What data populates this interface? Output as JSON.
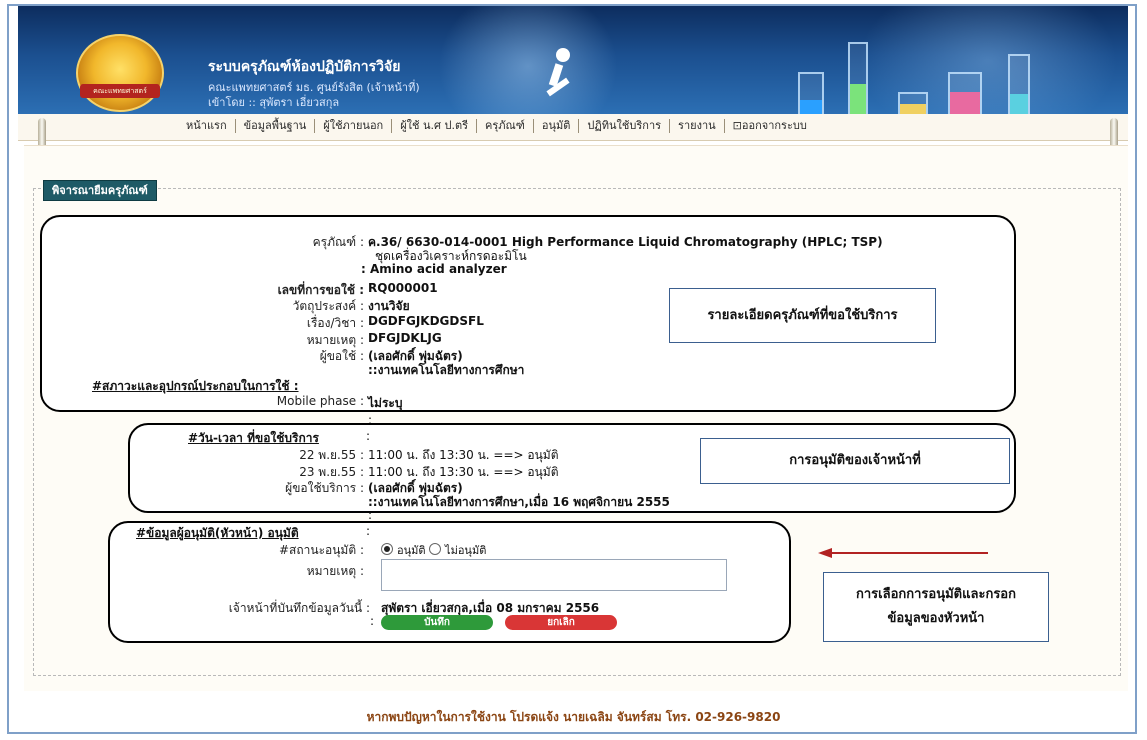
{
  "header": {
    "title": "ระบบครุภัณฑ์ห้องปฏิบัติการวิจัย",
    "subtitle": "คณะแพทยศาสตร์ มธ. ศูนย์รังสิต (เจ้าหน้าที่)",
    "login_text": "เข้าโดย :: สุพัตรา เอี่ยวสกุล"
  },
  "nav": {
    "items": [
      "หน้าแรก",
      "ข้อมูลพื้นฐาน",
      "ผู้ใช้ภายนอก",
      "ผู้ใช้ น.ศ ป.ตรี",
      "ครุภัณฑ์",
      "อนุมัติ",
      "ปฏิทินใช้บริการ",
      "รายงาน",
      "ออกจากระบบ"
    ]
  },
  "legend": "พิจารณายืมครุภัณฑ์",
  "equipment": {
    "label": "ครุภัณฑ์ :",
    "value_line1": "ค.36/ 6630-014-0001 High Performance Liquid Chromatography (HPLC; TSP)",
    "value_line2": "ชุดเครื่องวิเคราะห์กรดอะมิโน",
    "value_line3": ": Amino acid analyzer",
    "request_no_label": "เลขที่การขอใช้ :",
    "request_no": "RQ000001",
    "purpose_label": "วัตถุประสงค์ :",
    "purpose": "งานวิจัย",
    "subject_label": "เรื่อง/วิชา :",
    "subject": "DGDFGJKDGDSFL",
    "remark_label": "หมายเหตุ :",
    "remark": "DFGJDKLJG",
    "user_label": "ผู้ขอใช้ :",
    "user": "(เลอศักดิ์ พุ่มฉัตร)",
    "user_dept": "::งานเทคโนโลยีทางการศึกษา",
    "condition_label": "#สภาวะและอุปกรณ์ประกอบในการใช้ :",
    "mobile_label": "Mobile phase :",
    "mobile_value": "ไม่ระบุ"
  },
  "schedule": {
    "colon_above": ":",
    "header": "#วัน-เวลา ที่ขอใช้บริการ",
    "header_colon": ":",
    "rows": [
      {
        "date": "22 พ.ย.55 :",
        "time": "11:00 น. ถึง 13:30 น. ==> อนุมัติ"
      },
      {
        "date": "23 พ.ย.55 :",
        "time": "11:00 น. ถึง 13:30 น. ==> อนุมัติ"
      }
    ],
    "requester_label": "ผู้ขอใช้บริการ :",
    "requester": "(เลอศักดิ์ พุ่มฉัตร)",
    "requester_dept": "::งานเทคโนโลยีทางการศึกษา,เมื่อ 16 พฤศจิกายน 2555",
    "colon_below": ":"
  },
  "approver": {
    "header": "#ข้อมูลผู้อนุมัติ(หัวหน้า) อนุมัติ",
    "header_colon": ":",
    "status_label": "#สถานะอนุมัติ :",
    "option_approve": "อนุมัติ",
    "option_reject": "ไม่อนุมัติ",
    "remark_label": "หมายเหตุ :",
    "remark_value": "",
    "recorder_label": "เจ้าหน้าที่บันทึกข้อมูลวันนี้ :",
    "recorder": "สุพัตรา เอี่ยวสกุล,เมื่อ 08 มกราคม 2556",
    "btn_colon": ":",
    "save_label": "บันทึก",
    "cancel_label": "ยกเลิก"
  },
  "notes": {
    "equipment_note": "รายละเอียดครุภัณฑ์ที่ขอใช้บริการ",
    "approval_note": "การอนุมัติของเจ้าหน้าที่",
    "head_note_line1": "การเลือกการอนุมัติและกรอก",
    "head_note_line2": "ข้อมูลของหัวหน้า"
  },
  "footer": "หากพบปัญหาในการใช้งาน โปรดแจ้ง นายเฉลิม จันทร์สม โทร. 02-926-9820",
  "colors": {
    "banner": "#1b4f8f",
    "legend_bg": "#1e5a66",
    "save_btn": "#2e9a3a",
    "cancel_btn": "#d93636",
    "arrow": "#b22222",
    "footer_text": "#8b4513"
  }
}
